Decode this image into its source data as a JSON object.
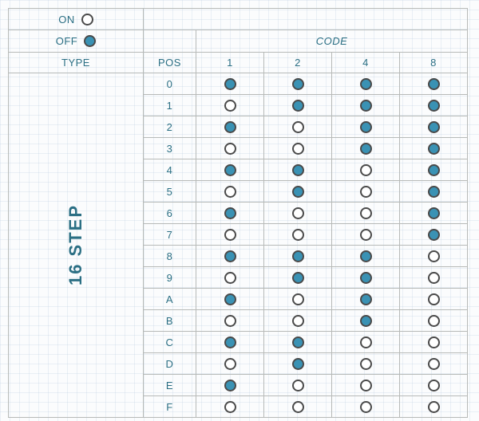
{
  "legend": {
    "on_label": "ON",
    "off_label": "OFF",
    "on_filled": false,
    "off_filled": true
  },
  "headers": {
    "type": "TYPE",
    "pos": "POS",
    "code": "CODE",
    "code_columns": [
      "1",
      "2",
      "4",
      "8"
    ]
  },
  "table": {
    "type_label": "16 STEP",
    "positions": [
      "0",
      "1",
      "2",
      "3",
      "4",
      "5",
      "6",
      "7",
      "8",
      "9",
      "A",
      "B",
      "C",
      "D",
      "E",
      "F"
    ]
  },
  "chart_data": {
    "type": "table",
    "title": "16 STEP rotary code — filled circle = OFF, open circle = ON",
    "columns": [
      "POS",
      "1",
      "2",
      "4",
      "8"
    ],
    "rows": [
      {
        "pos": "0",
        "code": {
          "1": "OFF",
          "2": "OFF",
          "4": "OFF",
          "8": "OFF"
        }
      },
      {
        "pos": "1",
        "code": {
          "1": "ON",
          "2": "OFF",
          "4": "OFF",
          "8": "OFF"
        }
      },
      {
        "pos": "2",
        "code": {
          "1": "OFF",
          "2": "ON",
          "4": "OFF",
          "8": "OFF"
        }
      },
      {
        "pos": "3",
        "code": {
          "1": "ON",
          "2": "ON",
          "4": "OFF",
          "8": "OFF"
        }
      },
      {
        "pos": "4",
        "code": {
          "1": "OFF",
          "2": "OFF",
          "4": "ON",
          "8": "OFF"
        }
      },
      {
        "pos": "5",
        "code": {
          "1": "ON",
          "2": "OFF",
          "4": "ON",
          "8": "OFF"
        }
      },
      {
        "pos": "6",
        "code": {
          "1": "OFF",
          "2": "ON",
          "4": "ON",
          "8": "OFF"
        }
      },
      {
        "pos": "7",
        "code": {
          "1": "ON",
          "2": "ON",
          "4": "ON",
          "8": "OFF"
        }
      },
      {
        "pos": "8",
        "code": {
          "1": "OFF",
          "2": "OFF",
          "4": "OFF",
          "8": "ON"
        }
      },
      {
        "pos": "9",
        "code": {
          "1": "ON",
          "2": "OFF",
          "4": "OFF",
          "8": "ON"
        }
      },
      {
        "pos": "A",
        "code": {
          "1": "OFF",
          "2": "ON",
          "4": "OFF",
          "8": "ON"
        }
      },
      {
        "pos": "B",
        "code": {
          "1": "ON",
          "2": "ON",
          "4": "OFF",
          "8": "ON"
        }
      },
      {
        "pos": "C",
        "code": {
          "1": "OFF",
          "2": "OFF",
          "4": "ON",
          "8": "ON"
        }
      },
      {
        "pos": "D",
        "code": {
          "1": "ON",
          "2": "OFF",
          "4": "ON",
          "8": "ON"
        }
      },
      {
        "pos": "E",
        "code": {
          "1": "OFF",
          "2": "ON",
          "4": "ON",
          "8": "ON"
        }
      },
      {
        "pos": "F",
        "code": {
          "1": "ON",
          "2": "ON",
          "4": "ON",
          "8": "ON"
        }
      }
    ]
  }
}
